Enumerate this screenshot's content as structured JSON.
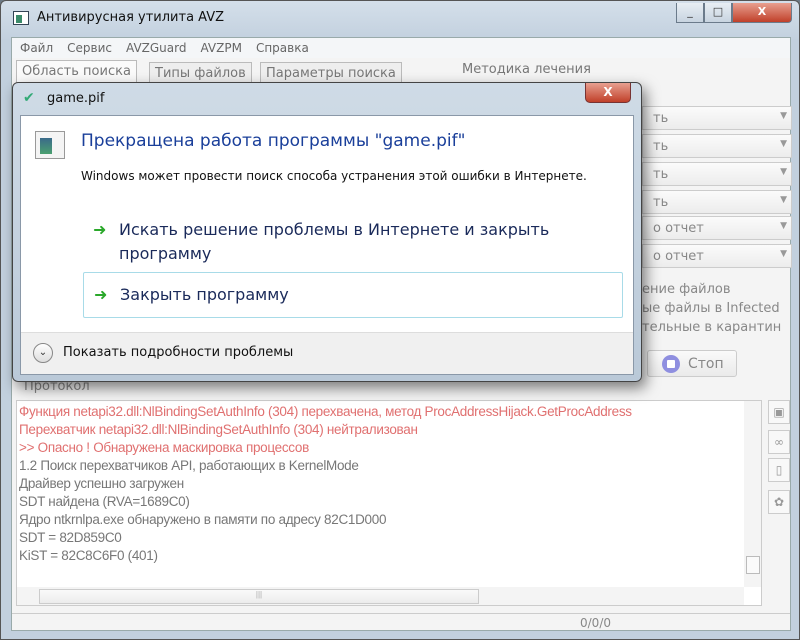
{
  "window": {
    "title": "Антивирусная утилита AVZ",
    "controls": [
      "_",
      "□",
      "X"
    ]
  },
  "menu": [
    "Файл",
    "Сервис",
    "AVZGuard",
    "AVZPM",
    "Справка"
  ],
  "tabs": [
    "Область поиска",
    "Типы файлов",
    "Параметры поиска"
  ],
  "method_label": "Методика лечения",
  "dropdowns": [
    "ть",
    "ть",
    "ть",
    "ть",
    "о отчет",
    "о отчет"
  ],
  "right_texts": [
    "ение файлов",
    "ые файлы в  Infected",
    "тельные в  карантин"
  ],
  "stop_label": "Стоп",
  "protocol_label": "Протокол",
  "log": [
    {
      "text": "Функция netapi32.dll:NlBindingSetAuthInfo (304) перехвачена, метод ProcAddressHijack.GetProcAddress",
      "color": "red"
    },
    {
      "text": "Перехватчик netapi32.dll:NlBindingSetAuthInfo (304) нейтрализован",
      "color": "red"
    },
    {
      "text": " >> Опасно ! Обнаружена маскировка процессов",
      "color": "red"
    },
    {
      "text": "1.2 Поиск перехватчиков API, работающих в KernelMode",
      "color": "gray"
    },
    {
      "text": " Драйвер успешно загружен",
      "color": "gray"
    },
    {
      "text": " SDT найдена (RVA=1689C0)",
      "color": "gray"
    },
    {
      "text": " Ядро ntkrnlpa.exe обнаружено в памяти по адресу 82C1D000",
      "color": "gray"
    },
    {
      "text": "   SDT = 82D859C0",
      "color": "gray"
    },
    {
      "text": "   KiST = 82C8C6F0 (401)",
      "color": "gray"
    }
  ],
  "status": "0/0/0",
  "dialog": {
    "title": "game.pif",
    "close": "X",
    "heading": "Прекращена работа программы \"game.pif\"",
    "subtext": "Windows может провести поиск способа устранения этой ошибки в Интернете.",
    "option1": "Искать решение проблемы в Интернете и закрыть программу",
    "option2": "Закрыть программу",
    "details": "Показать подробности проблемы"
  },
  "colors": {
    "heading": "#1a3f9a",
    "log_red": "#e07070",
    "arrow": "#2aa82a"
  }
}
